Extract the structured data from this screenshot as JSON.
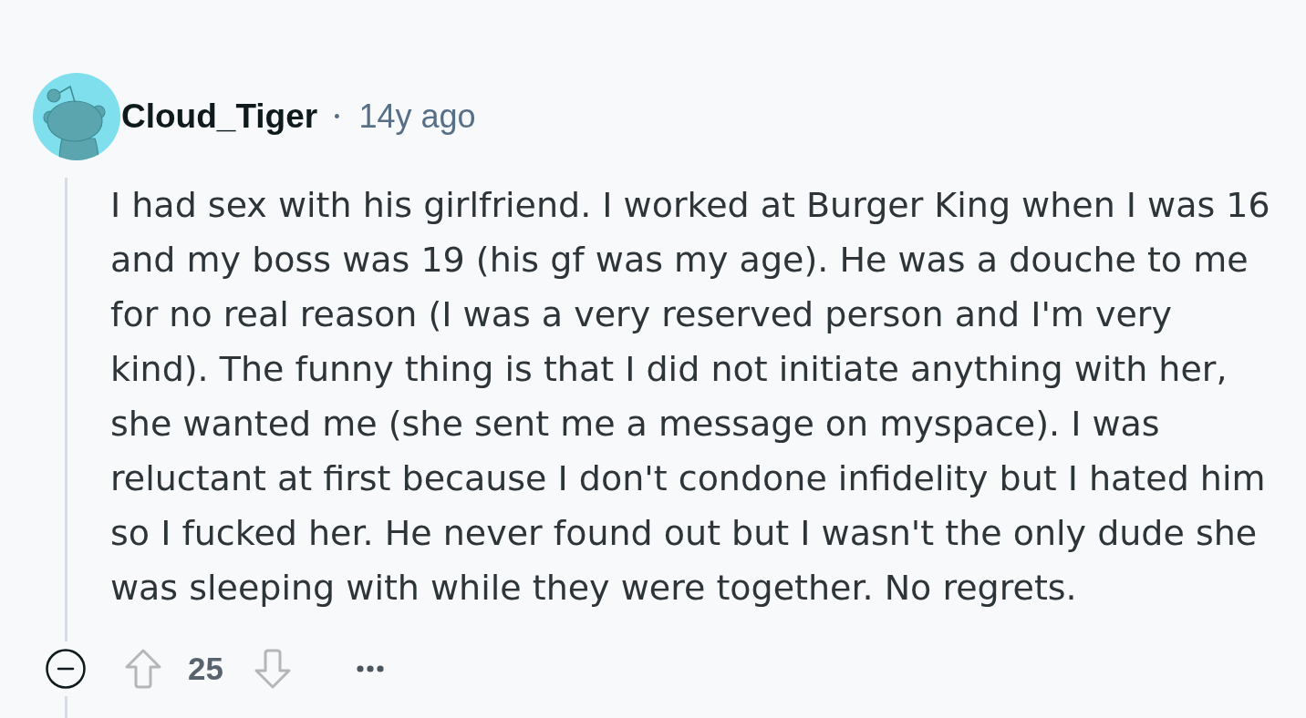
{
  "comment": {
    "author": "Cloud_Tiger",
    "separator": "•",
    "age": "14y ago",
    "body": "I had sex with his girlfriend. I worked at Burger King when I was 16 and my boss was 19 (his gf was my age). He was a douche to me for no real reason (I was a very reserved person and I'm very kind). The funny thing is that I did not initiate anything with her, she wanted me (she sent me a message on myspace). I was reluctant at first because I don't condone infidelity but I hated him so I fucked her. He never found out but I wasn't the only dude she was sleeping with while they were together. No regrets.",
    "expanded": true,
    "score": "25"
  }
}
